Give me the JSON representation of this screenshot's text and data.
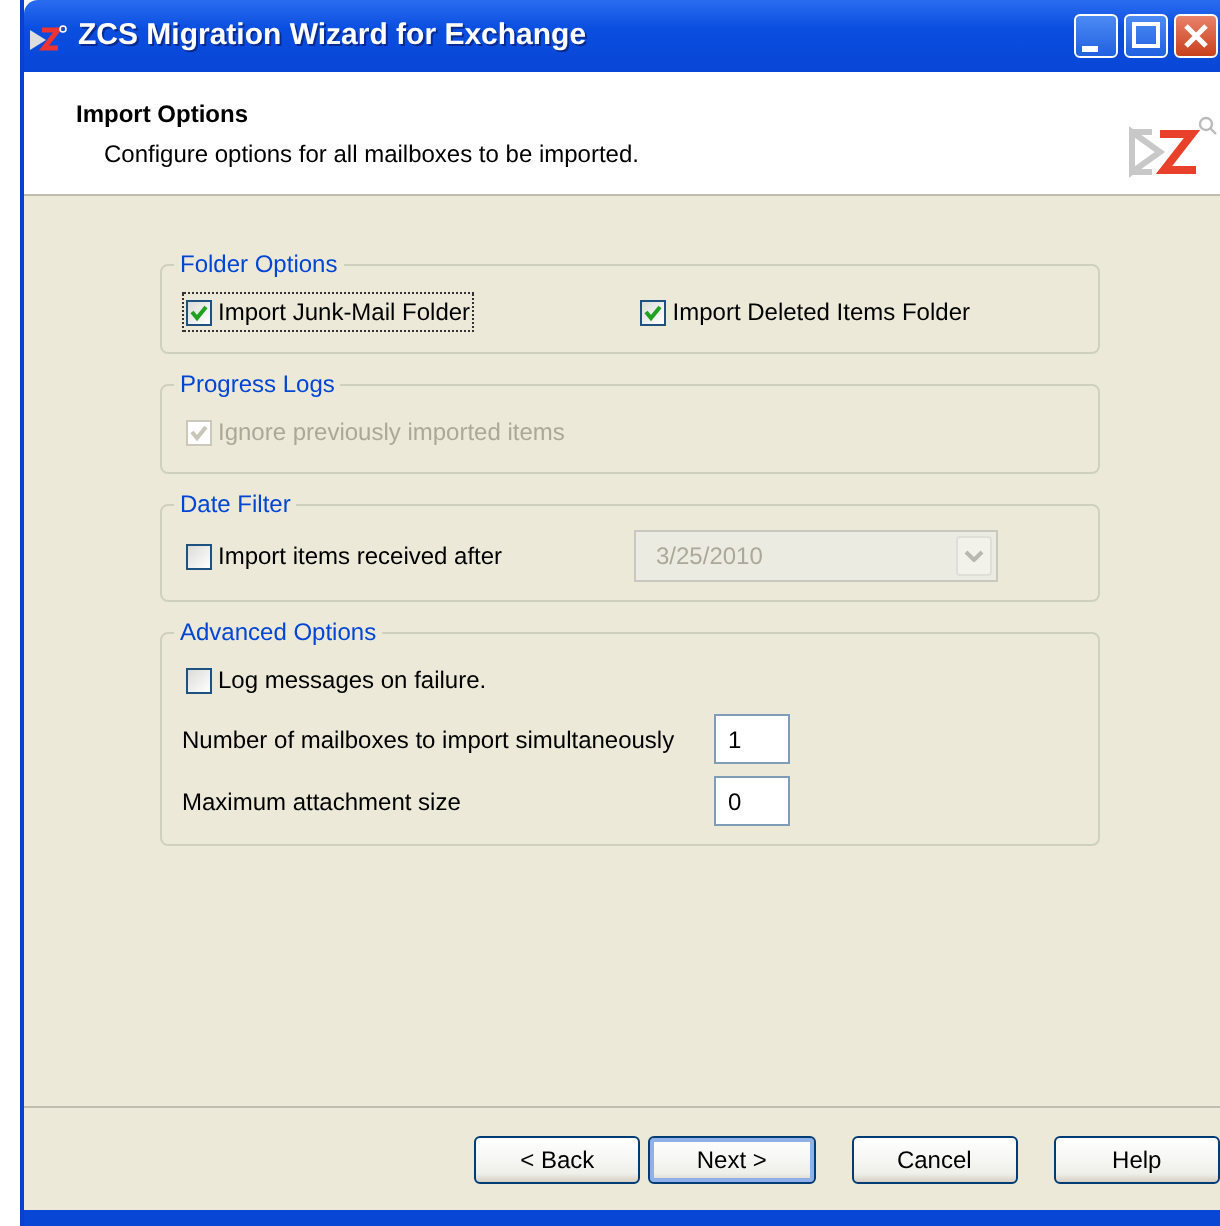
{
  "window": {
    "title": "ZCS Migration Wizard for Exchange"
  },
  "header": {
    "title": "Import Options",
    "subtitle": "Configure options for all mailboxes to be imported."
  },
  "groups": [
    {
      "legend": "Folder Options",
      "rows": [
        [
          {
            "kind": "checkbox",
            "label": "Import Junk-Mail Folder",
            "checked": true,
            "disabled": false,
            "focused": true
          },
          {
            "kind": "checkbox",
            "label": "Import Deleted Items Folder",
            "checked": true,
            "disabled": false,
            "focused": false
          }
        ]
      ]
    },
    {
      "legend": "Progress Logs",
      "rows": [
        [
          {
            "kind": "checkbox",
            "label": "Ignore previously imported items",
            "checked": true,
            "disabled": true,
            "focused": false
          }
        ]
      ]
    },
    {
      "legend": "Date Filter",
      "rows": [
        [
          {
            "kind": "checkbox",
            "label": "Import items received after",
            "checked": false,
            "disabled": false,
            "focused": false
          },
          {
            "kind": "date",
            "value": "3/25/2010",
            "disabled": true
          }
        ]
      ]
    },
    {
      "legend": "Advanced Options",
      "rows": [
        [
          {
            "kind": "checkbox",
            "label": "Log messages on failure.",
            "checked": false,
            "disabled": false,
            "focused": false
          }
        ],
        [
          {
            "kind": "number",
            "label": "Number of mailboxes to import simultaneously",
            "value": "1"
          }
        ],
        [
          {
            "kind": "number",
            "label": "Maximum attachment size",
            "value": "0"
          }
        ]
      ]
    }
  ],
  "buttons": [
    {
      "label": "< Back",
      "default": false
    },
    {
      "label": "Next >",
      "default": true
    },
    {
      "label": "Cancel",
      "default": false
    },
    {
      "label": "Help",
      "default": false
    }
  ]
}
